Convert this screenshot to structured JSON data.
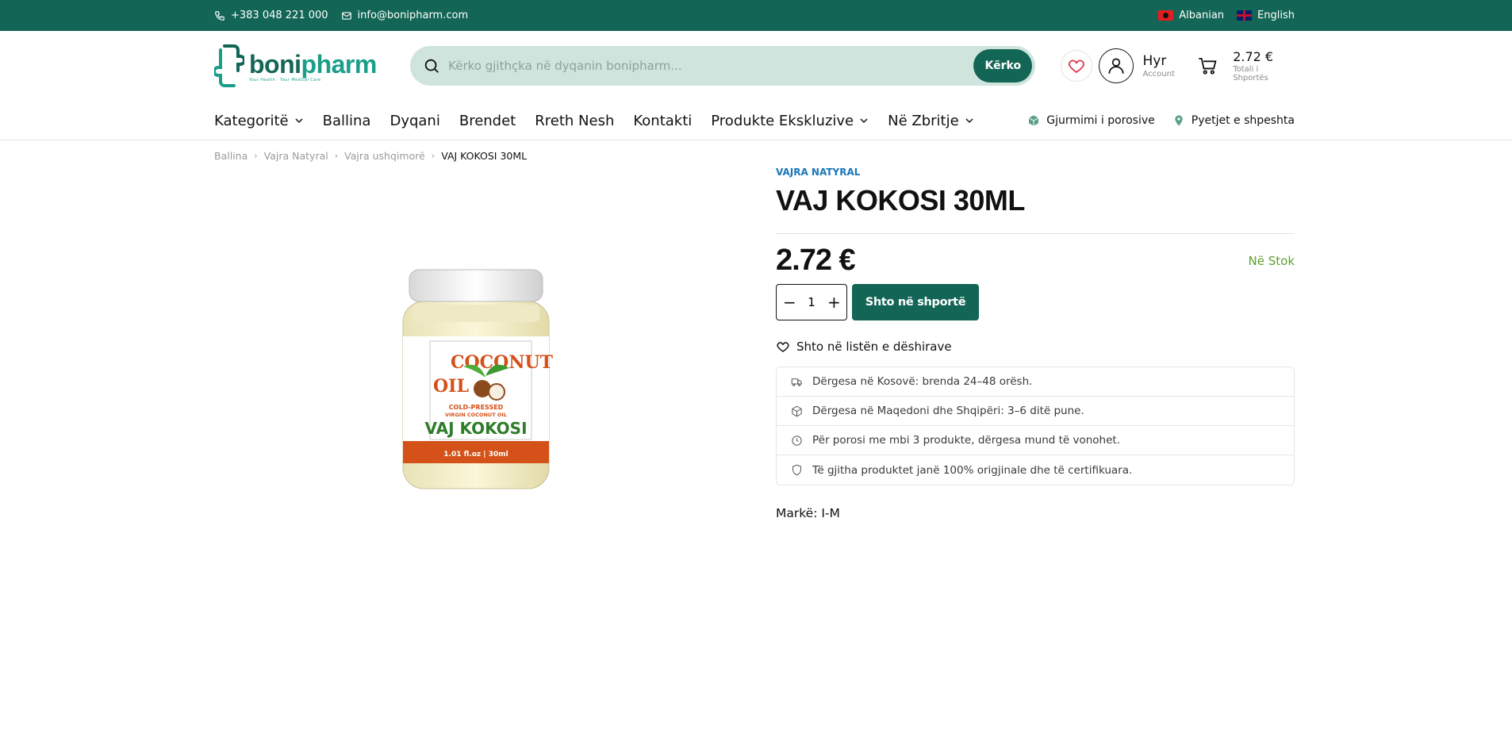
{
  "topbar": {
    "phone": "+383 048 221 000",
    "email": "info@bonipharm.com",
    "languages": [
      {
        "label": "Albanian",
        "flag": "albania-flag-icon"
      },
      {
        "label": "English",
        "flag": "uk-flag-icon"
      }
    ],
    "bg_color": "#136656"
  },
  "header": {
    "logo": {
      "part1": "boni",
      "part2": "pharm",
      "tagline": "Your Health · Your Medical Care"
    },
    "search": {
      "placeholder": "Kërko gjithçka në dyqanin bonipharm...",
      "button": "Kërko"
    },
    "account": {
      "title": "Hyr",
      "subtitle": "Account"
    },
    "cart": {
      "price": "2.72 €",
      "subtitle": "Totali i Shportës"
    }
  },
  "nav": {
    "items": [
      {
        "label": "Kategoritë",
        "dropdown": true
      },
      {
        "label": "Ballina"
      },
      {
        "label": "Dyqani"
      },
      {
        "label": "Brendet"
      },
      {
        "label": "Rreth Nesh"
      },
      {
        "label": "Kontakti"
      },
      {
        "label": "Produkte Ekskluzive",
        "dropdown": true
      },
      {
        "label": "Në Zbritje",
        "dropdown": true
      }
    ],
    "utilities": [
      {
        "label": "Gjurmimi i porosive",
        "icon": "package-icon"
      },
      {
        "label": "Pyetjet e shpeshta",
        "icon": "map-pin-icon"
      }
    ]
  },
  "breadcrumb": [
    "Ballina",
    "Vajra Natyral",
    "Vajra ushqimorë",
    "VAJ KOKOSI 30ML"
  ],
  "product": {
    "category": "VAJRA NATYRAL",
    "title": "VAJ KOKOSI 30ML",
    "price": "2.72 €",
    "stock": "Në Stok",
    "quantity": "1",
    "add_to_cart": "Shto në shportë",
    "wishlist": "Shto në listën e dëshirave",
    "features": [
      {
        "icon": "truck-icon",
        "text": "Dërgesa në Kosovë: brenda 24–48 orësh."
      },
      {
        "icon": "box-icon",
        "text": "Dërgesa në Maqedoni dhe Shqipëri: 3–6 ditë pune."
      },
      {
        "icon": "clock-icon",
        "text": "Për porosi me mbi 3 produkte, dërgesa mund të vonohet."
      },
      {
        "icon": "shield-icon",
        "text": "Të gjitha produktet janë 100% origjinale dhe të certifikuara."
      }
    ],
    "brand": "Markë: I-M",
    "jar": {
      "label_line1": "COCONUT",
      "label_line2": "OIL",
      "label_sub1": "COLD-PRESSED",
      "label_sub2": "VIRGIN COCONUT OIL",
      "label_name": "VAJ KOKOSI",
      "label_size": "1.01 fl.oz | 30ml"
    }
  }
}
